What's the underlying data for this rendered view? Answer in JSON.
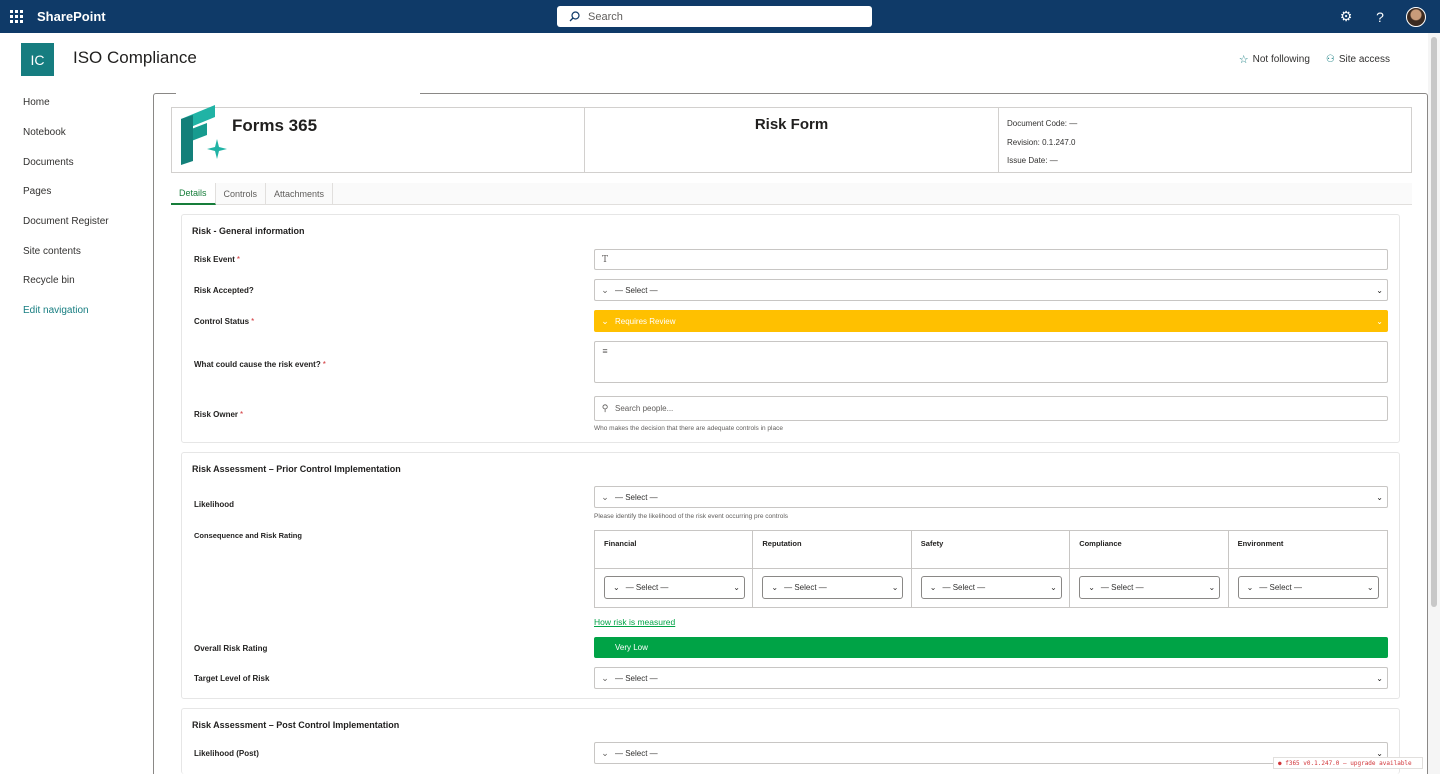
{
  "suitebar": {
    "brand": "SharePoint",
    "search_placeholder": "Search",
    "icons": [
      "waffle-icon",
      "search-icon",
      "settings-icon",
      "help-icon",
      "avatar"
    ]
  },
  "site": {
    "logo_text": "IC",
    "title": "ISO Compliance",
    "follow_label": "Not following",
    "access_label": "Site access"
  },
  "nav": {
    "items": [
      "Home",
      "Notebook",
      "Documents",
      "Pages",
      "Document Register",
      "Site contents",
      "Recycle bin",
      "Edit navigation"
    ]
  },
  "form_header": {
    "brand": "Forms 365",
    "title": "Risk Form",
    "document_code": "Document Code: —",
    "revision": "Revision: 0.1.247.0",
    "issue_date": "Issue Date: —"
  },
  "tabs": [
    "Details",
    "Controls",
    "Attachments"
  ],
  "general": {
    "title": "Risk - General information",
    "risk_event_label": "Risk Event",
    "risk_accepted_label": "Risk Accepted?",
    "risk_accepted_value": "— Select —",
    "control_status_label": "Control Status",
    "control_status_value": "Requires Review",
    "cause_label": "What could cause the risk event?",
    "owner_label": "Risk Owner",
    "owner_placeholder": "Search people...",
    "owner_hint": "Who makes the decision that there are adequate controls in place"
  },
  "prior": {
    "title": "Risk Assessment – Prior Control Implementation",
    "likelihood_label": "Likelihood",
    "likelihood_value": "— Select —",
    "likelihood_hint": "Please identify the likelihood of the risk event occurring pre controls",
    "consequence_label": "Consequence and Risk Rating",
    "consequence_columns": [
      {
        "name": "Financial",
        "value": "— Select —"
      },
      {
        "name": "Reputation",
        "value": "— Select —"
      },
      {
        "name": "Safety",
        "value": "— Select —"
      },
      {
        "name": "Compliance",
        "value": "— Select —"
      },
      {
        "name": "Environment",
        "value": "— Select —"
      }
    ],
    "measure_link": "How risk is measured",
    "overall_label": "Overall Risk Rating",
    "overall_value": "Very Low",
    "target_label": "Target Level of Risk",
    "target_value": "— Select —"
  },
  "post": {
    "title": "Risk Assessment – Post Control Implementation",
    "likelihood_label": "Likelihood (Post)",
    "likelihood_value": "— Select —"
  },
  "version_badge": "● f365 v0.1.247.0 — upgrade available",
  "colors": {
    "suitebar": "#0f3a68",
    "site_accent": "#167d80",
    "status_yellow": "#ffc000",
    "rating_green": "#00a346",
    "required": "#d13438"
  }
}
